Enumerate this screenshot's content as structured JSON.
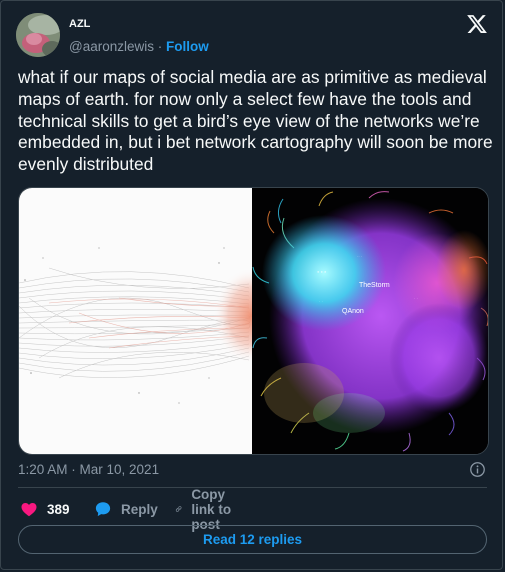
{
  "author": {
    "name": "AZL",
    "handle": "@aaronzlewis",
    "separator": " · ",
    "follow_label": "Follow"
  },
  "tweet": {
    "text": "what if our maps of social media are as primitive as medieval maps of earth. for now only a select few have the tools and technical skills to get a bird’s eye view of the networks we’re embedded in, but i bet network cartography will soon be more evenly distributed"
  },
  "media": {
    "labels": {
      "qanon": "QAnon",
      "thestorm": "TheStorm"
    }
  },
  "timestamp": "1:20 AM · Mar 10, 2021",
  "actions": {
    "like_count": "389",
    "reply_label": "Reply",
    "copy_label": "Copy link to post"
  },
  "read_replies_label": "Read 12 replies",
  "colors": {
    "background": "#15202b",
    "accent": "#1d9bf0",
    "like": "#f91880",
    "muted": "#8b98a5"
  }
}
